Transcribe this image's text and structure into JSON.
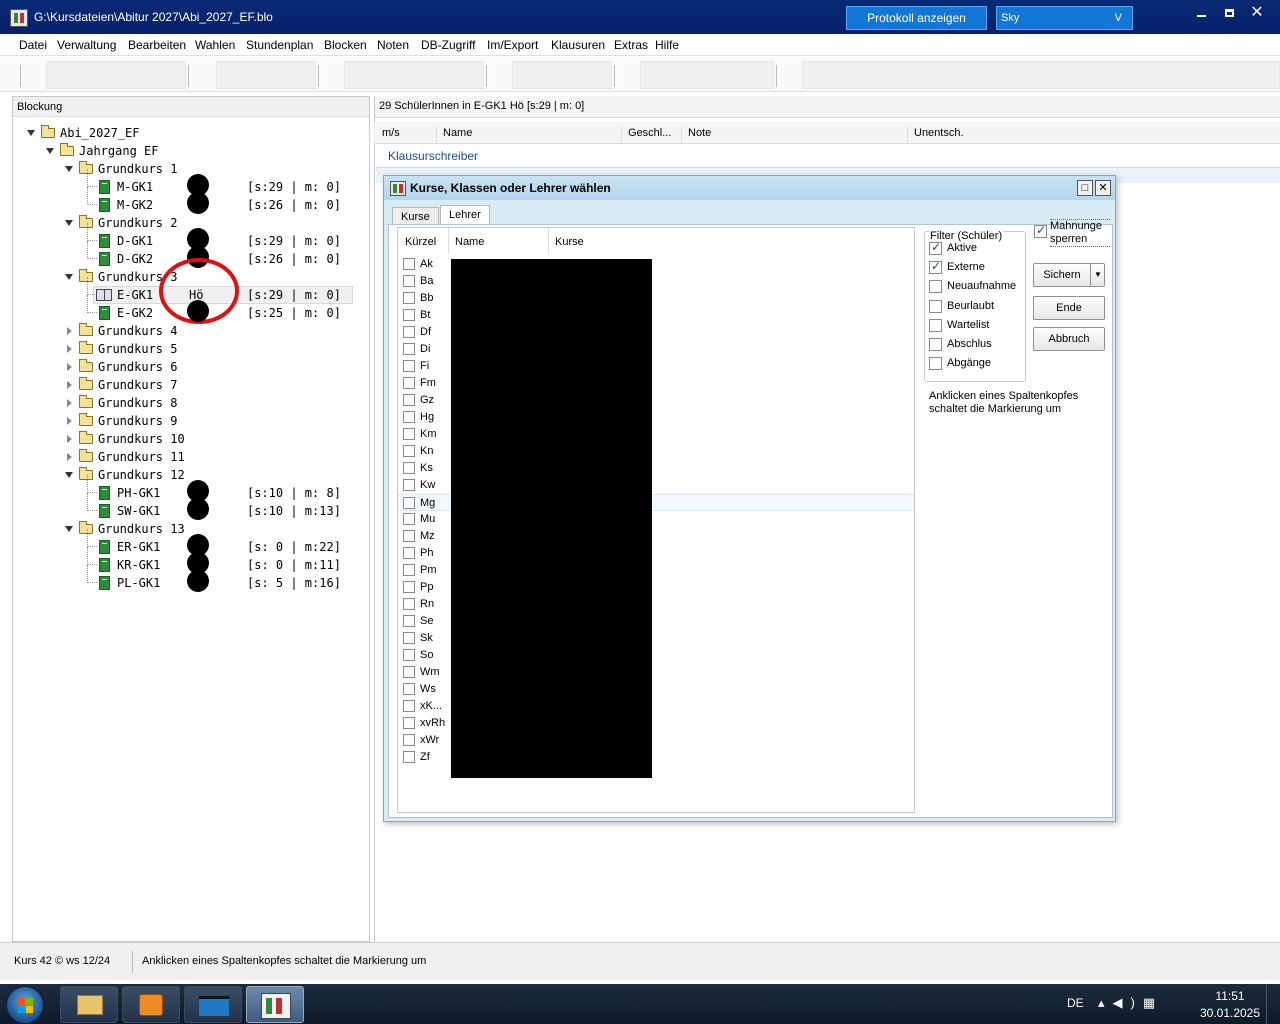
{
  "window": {
    "title": "G:\\Kursdateien\\Abitur 2027\\Abi_2027_EF.blo",
    "protokoll_button": "Protokoll anzeigen",
    "skin_select": "Sky",
    "skin_arrow": "V"
  },
  "menu": [
    "Datei",
    "Verwaltung",
    "Bearbeiten",
    "Wahlen",
    "Stundenplan",
    "Blocken",
    "Noten",
    "DB-Zugriff",
    "Im/Export",
    "Klausuren",
    "Extras",
    "Hilfe"
  ],
  "left_panel": {
    "header": "Blockung",
    "tree": {
      "root": "Abi_2027_EF",
      "jahrgang": "Jahrgang EF",
      "groups": [
        {
          "name": "Grundkurs 1",
          "open": true,
          "courses": [
            {
              "code": "M-GK1",
              "teacher": "",
              "stats": "[s:29 | m: 0]"
            },
            {
              "code": "M-GK2",
              "teacher": "",
              "stats": "[s:26 | m: 0]"
            }
          ]
        },
        {
          "name": "Grundkurs 2",
          "open": true,
          "courses": [
            {
              "code": "D-GK1",
              "teacher": "",
              "stats": "[s:29 | m: 0]"
            },
            {
              "code": "D-GK2",
              "teacher": "",
              "stats": "[s:26 | m: 0]"
            }
          ]
        },
        {
          "name": "Grundkurs 3",
          "open": true,
          "courses": [
            {
              "code": "E-GK1",
              "teacher": "Hö",
              "stats": "[s:29 | m: 0]",
              "selected": true
            },
            {
              "code": "E-GK2",
              "teacher": "",
              "stats": "[s:25 | m: 0]"
            }
          ]
        },
        {
          "name": "Grundkurs 4",
          "open": false,
          "courses": []
        },
        {
          "name": "Grundkurs 5",
          "open": false,
          "courses": []
        },
        {
          "name": "Grundkurs 6",
          "open": false,
          "courses": []
        },
        {
          "name": "Grundkurs 7",
          "open": false,
          "courses": []
        },
        {
          "name": "Grundkurs 8",
          "open": false,
          "courses": []
        },
        {
          "name": "Grundkurs 9",
          "open": false,
          "courses": []
        },
        {
          "name": "Grundkurs 10",
          "open": false,
          "courses": []
        },
        {
          "name": "Grundkurs 11",
          "open": false,
          "courses": []
        },
        {
          "name": "Grundkurs 12",
          "open": true,
          "courses": [
            {
              "code": "PH-GK1",
              "teacher": "",
              "stats": "[s:10 | m: 8]"
            },
            {
              "code": "SW-GK1",
              "teacher": "",
              "stats": "[s:10 | m:13]"
            }
          ]
        },
        {
          "name": "Grundkurs 13",
          "open": true,
          "courses": [
            {
              "code": "ER-GK1",
              "teacher": "",
              "stats": "[s: 0 | m:22]"
            },
            {
              "code": "KR-GK1",
              "teacher": "",
              "stats": "[s: 0 | m:11]"
            },
            {
              "code": "PL-GK1",
              "teacher": "",
              "stats": "[s: 5 | m:16]"
            }
          ]
        }
      ]
    }
  },
  "right_panel": {
    "header": "29 SchülerInnen in E-GK1   Hö     [s:29 | m: 0]",
    "columns": [
      "m/s",
      "Name",
      "Geschl...",
      "Note",
      "Unentsch."
    ],
    "klausurschreiber": "Klausurschreiber"
  },
  "dialog": {
    "title": "Kurse, Klassen oder Lehrer wählen",
    "tabs": [
      "Kurse",
      "Lehrer"
    ],
    "active_tab": "Lehrer",
    "list_columns": [
      "Kürzel",
      "Name",
      "Kurse"
    ],
    "teachers": [
      "Ak",
      "Ba",
      "Bb",
      "Bt",
      "Df",
      "Di",
      "Fi",
      "Fm",
      "Gz",
      "Hg",
      "Km",
      "Kn",
      "Ks",
      "Kw",
      "Mg",
      "Mu",
      "Mz",
      "Ph",
      "Pm",
      "Pp",
      "Rn",
      "Se",
      "Sk",
      "So",
      "Wm",
      "Ws",
      "xK...",
      "xvRh",
      "xWr",
      "Zf"
    ],
    "hover_row": "Mg",
    "filter": {
      "title": "Filter (Schüler)",
      "items": [
        {
          "label": "Aktive",
          "checked": true
        },
        {
          "label": "Externe",
          "checked": true
        },
        {
          "label": "Neuaufnahme",
          "checked": false
        },
        {
          "label": "Beurlaubt",
          "checked": false
        },
        {
          "label": "Wartelist",
          "checked": false
        },
        {
          "label": "Abschlus",
          "checked": false
        },
        {
          "label": "Abgänge",
          "checked": false
        }
      ]
    },
    "mahnung_label": "Mahnunge sperren",
    "buttons": {
      "save": "Sichern",
      "end": "Ende",
      "cancel": "Abbruch"
    },
    "hint": "Anklicken eines Spaltenkopfes schaltet die Markierung um"
  },
  "statusbar": {
    "left": "Kurs 42 © ws 12/24",
    "message": "Anklicken eines Spaltenkopfes schaltet die Markierung um"
  },
  "taskbar": {
    "language": "DE",
    "time": "11:51",
    "date": "30.01.2025"
  }
}
